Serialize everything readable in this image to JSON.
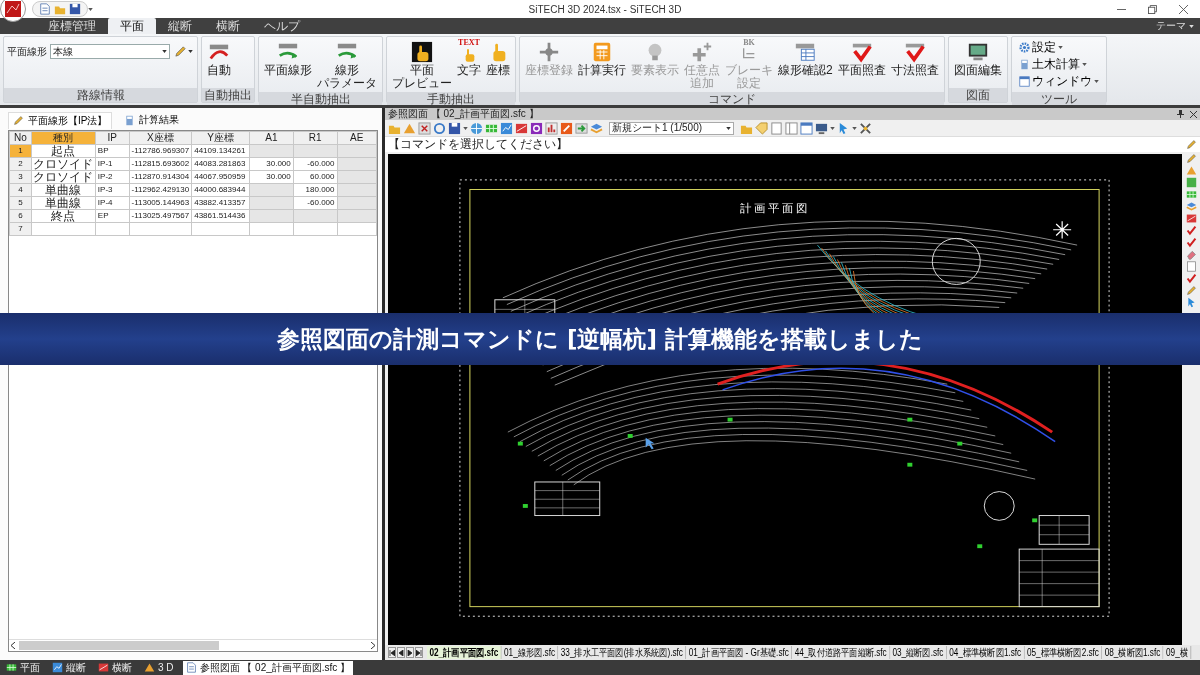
{
  "window": {
    "title": "SiTECH 3D 2024.tsx - SiTECH 3D"
  },
  "ribbon_tabs": [
    {
      "label": "座標管理",
      "selected": false
    },
    {
      "label": "平面",
      "selected": true
    },
    {
      "label": "縦断",
      "selected": false
    },
    {
      "label": "横断",
      "selected": false
    },
    {
      "label": "ヘルプ",
      "selected": false
    }
  ],
  "theme_menu": "テーマ",
  "ribbon_groups": [
    {
      "title": "路線情報",
      "kind": "selector",
      "label": "平面線形",
      "value": "本線"
    },
    {
      "title": "自動抽出",
      "kind": "buttons",
      "buttons": [
        {
          "label": "自動",
          "disabled": false
        }
      ]
    },
    {
      "title": "半自動抽出",
      "kind": "buttons",
      "buttons": [
        {
          "label": "平面線形",
          "disabled": false
        },
        {
          "lines": [
            "線形",
            "パラメータ"
          ],
          "disabled": false
        }
      ]
    },
    {
      "title": "手動抽出",
      "kind": "buttons",
      "buttons": [
        {
          "lines": [
            "平面",
            "プレビュー"
          ],
          "disabled": false
        },
        {
          "label": "文字",
          "disabled": false,
          "badge": "TEXT"
        },
        {
          "label": "座標",
          "disabled": false
        }
      ]
    },
    {
      "title": "コマンド",
      "kind": "buttons",
      "buttons": [
        {
          "label": "座標登録",
          "disabled": true
        },
        {
          "label": "計算実行",
          "disabled": false
        },
        {
          "label": "要素表示",
          "disabled": true
        },
        {
          "lines": [
            "任意点",
            "追加"
          ],
          "disabled": true
        },
        {
          "lines": [
            "ブレーキ",
            "設定"
          ],
          "disabled": true,
          "badge": "BK"
        },
        {
          "label": "線形確認2",
          "disabled": false
        },
        {
          "label": "平面照査",
          "disabled": false
        },
        {
          "label": "寸法照査",
          "disabled": false
        }
      ]
    },
    {
      "title": "図面",
      "kind": "buttons",
      "buttons": [
        {
          "label": "図面編集",
          "disabled": false
        }
      ]
    },
    {
      "title": "ツール",
      "kind": "menu",
      "items": [
        "設定",
        "土木計算",
        "ウィンドウ"
      ]
    }
  ],
  "left_panel": {
    "tabs": [
      {
        "label": "平面線形【IP法】",
        "selected": true
      },
      {
        "label": "計算結果",
        "selected": false
      }
    ],
    "table": {
      "row_header": "No",
      "columns": [
        {
          "label": "種別",
          "selected": true
        },
        {
          "label": "IP",
          "selected": false
        },
        {
          "label": "X座標",
          "selected": false
        },
        {
          "label": "Y座標",
          "selected": false
        },
        {
          "label": "A1",
          "selected": false
        },
        {
          "label": "R1",
          "selected": false
        },
        {
          "label": "AE",
          "selected": false
        }
      ],
      "rows": [
        {
          "no": "1",
          "selected": true,
          "cells": [
            {
              "text": "起点",
              "disabled": false
            },
            {
              "text": "BP",
              "disabled": false
            },
            {
              "text": "-112786.969307",
              "disabled": false
            },
            {
              "text": "44109.134261",
              "disabled": false
            },
            {
              "disabled": true
            },
            {
              "disabled": true
            },
            {
              "disabled": true
            }
          ]
        },
        {
          "no": "2",
          "selected": false,
          "cells": [
            {
              "text": "クロソイド",
              "disabled": false
            },
            {
              "text": "IP-1",
              "disabled": false
            },
            {
              "text": "-112815.693602",
              "disabled": false
            },
            {
              "text": "44083.281863",
              "disabled": false
            },
            {
              "text": "30.000",
              "disabled": false
            },
            {
              "text": "-60.000",
              "disabled": false
            },
            {
              "disabled": true
            }
          ]
        },
        {
          "no": "3",
          "selected": false,
          "cells": [
            {
              "text": "クロソイド",
              "disabled": false
            },
            {
              "text": "IP-2",
              "disabled": false
            },
            {
              "text": "-112870.914304",
              "disabled": false
            },
            {
              "text": "44067.950959",
              "disabled": false
            },
            {
              "text": "30.000",
              "disabled": false
            },
            {
              "text": "60.000",
              "disabled": false
            },
            {
              "disabled": true
            }
          ]
        },
        {
          "no": "4",
          "selected": false,
          "cells": [
            {
              "text": "単曲線",
              "disabled": false
            },
            {
              "text": "IP-3",
              "disabled": false
            },
            {
              "text": "-112962.429130",
              "disabled": false
            },
            {
              "text": "44000.683944",
              "disabled": false
            },
            {
              "disabled": true
            },
            {
              "text": "180.000",
              "disabled": false
            },
            {
              "disabled": true
            }
          ]
        },
        {
          "no": "5",
          "selected": false,
          "cells": [
            {
              "text": "単曲線",
              "disabled": false
            },
            {
              "text": "IP-4",
              "disabled": false
            },
            {
              "text": "-113005.144963",
              "disabled": false
            },
            {
              "text": "43882.413357",
              "disabled": false
            },
            {
              "disabled": true
            },
            {
              "text": "-60.000",
              "disabled": false
            },
            {
              "disabled": true
            }
          ]
        },
        {
          "no": "6",
          "selected": false,
          "cells": [
            {
              "text": "終点",
              "disabled": false
            },
            {
              "text": "EP",
              "disabled": false
            },
            {
              "text": "-113025.497567",
              "disabled": false
            },
            {
              "text": "43861.514436",
              "disabled": false
            },
            {
              "disabled": true
            },
            {
              "disabled": true
            },
            {
              "disabled": true
            }
          ]
        },
        {
          "no": "7",
          "selected": false,
          "cells": []
        }
      ]
    }
  },
  "reference_panel": {
    "title": "参照図面 【 02_計画平面図.sfc 】",
    "sheet": "新規シート1 (1/500)",
    "command_prompt": "【コマンドを選択してください】",
    "drawing_title": "計画平面図",
    "sheet_tabs": [
      {
        "label": "02_計画平面図.sfc",
        "selected": true
      },
      {
        "label": "01_線形図.sfc",
        "selected": false
      },
      {
        "label": "33_排水工平面図(排水系統図).sfc",
        "selected": false
      },
      {
        "label": "01_計画平面図 - Gr基礎.sfc",
        "selected": false
      },
      {
        "label": "44_取付道路平面縦断.sfc",
        "selected": false
      },
      {
        "label": "03_縦断図.sfc",
        "selected": false
      },
      {
        "label": "04_標準横断図1.sfc",
        "selected": false
      },
      {
        "label": "05_標準横断図2.sfc",
        "selected": false
      },
      {
        "label": "08_横断図1.sfc",
        "selected": false
      },
      {
        "label": "09_横",
        "selected": false
      }
    ]
  },
  "taskbar": [
    {
      "label": "平面",
      "selected": false
    },
    {
      "label": "縦断",
      "selected": false
    },
    {
      "label": "横断",
      "selected": false
    },
    {
      "label": "3 D",
      "selected": false
    },
    {
      "label": "参照図面 【 02_計画平面図.sfc 】",
      "selected": true
    }
  ],
  "caption": "参照図面の計測コマンドに [逆幅杭] 計算機能を搭載しました"
}
